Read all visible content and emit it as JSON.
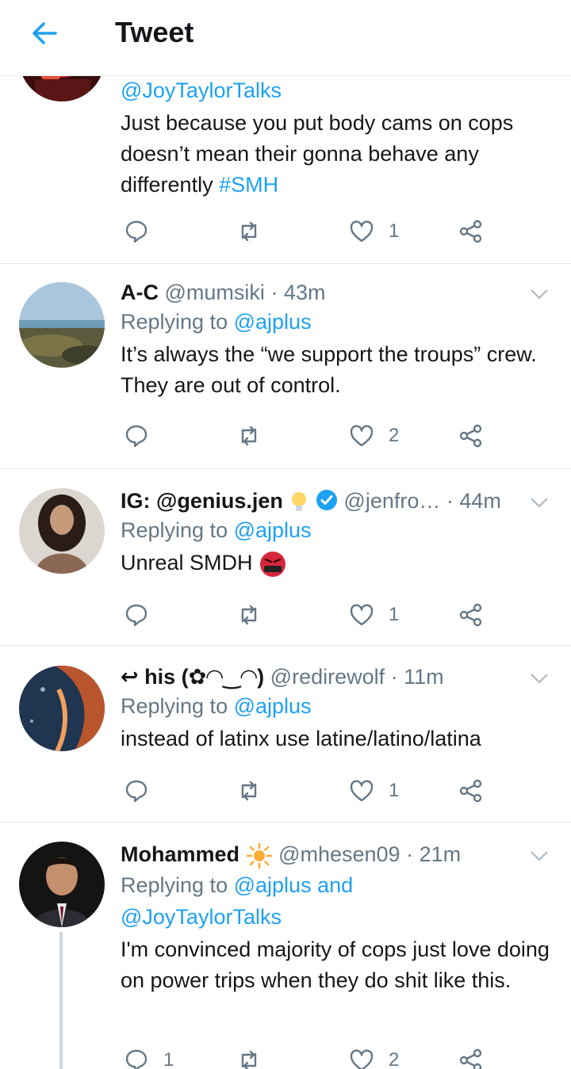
{
  "header": {
    "title": "Tweet"
  },
  "tweets": [
    {
      "mention": "@JoyTaylorTalks",
      "text_main": "Just because you put body cams on cops doesn’t mean their gonna behave any differently ",
      "hashtag": "#SMH",
      "reply_count": "",
      "like_count": "1"
    },
    {
      "name": "A-C",
      "handle": "@mumsiki",
      "time": "· 43m",
      "replying_label": "Replying to",
      "replying_to": "@ajplus",
      "text": "It’s always the “we support the troups” crew. They are out of control.",
      "like_count": "2"
    },
    {
      "name": "IG: @genius.jen",
      "handle": "@jenfro…",
      "time": "· 44m",
      "replying_label": "Replying to",
      "replying_to": "@ajplus",
      "text": "Unreal SMDH",
      "like_count": "1"
    },
    {
      "name_prefix": "↩",
      "name": "his (✿◠‿◠)",
      "handle": "@redirewolf",
      "time": "· 11m",
      "replying_label": "Replying to",
      "replying_to": "@ajplus",
      "text": "instead of latinx use latine/latino/latina",
      "like_count": "1"
    },
    {
      "name": "Mohammed",
      "handle": "@mhesen09",
      "time": "· 21m",
      "replying_label": "Replying to",
      "replying_to": "@ajplus and",
      "replying_to_2": "@JoyTaylorTalks",
      "text": "I'm convinced majority of cops just love doing on power trips when they do shit like this.",
      "reply_count": "1",
      "like_count": "2"
    }
  ],
  "colors": {
    "accent": "#1da1f2",
    "secondary": "#657786",
    "text": "#14171a",
    "border": "#e1e8ed"
  },
  "icons": [
    "back-arrow-icon",
    "reply-icon",
    "retweet-icon",
    "like-icon",
    "share-icon",
    "chevron-down-icon",
    "verified-icon",
    "lightbulb-icon",
    "sun-icon",
    "angry-emoji-icon"
  ]
}
